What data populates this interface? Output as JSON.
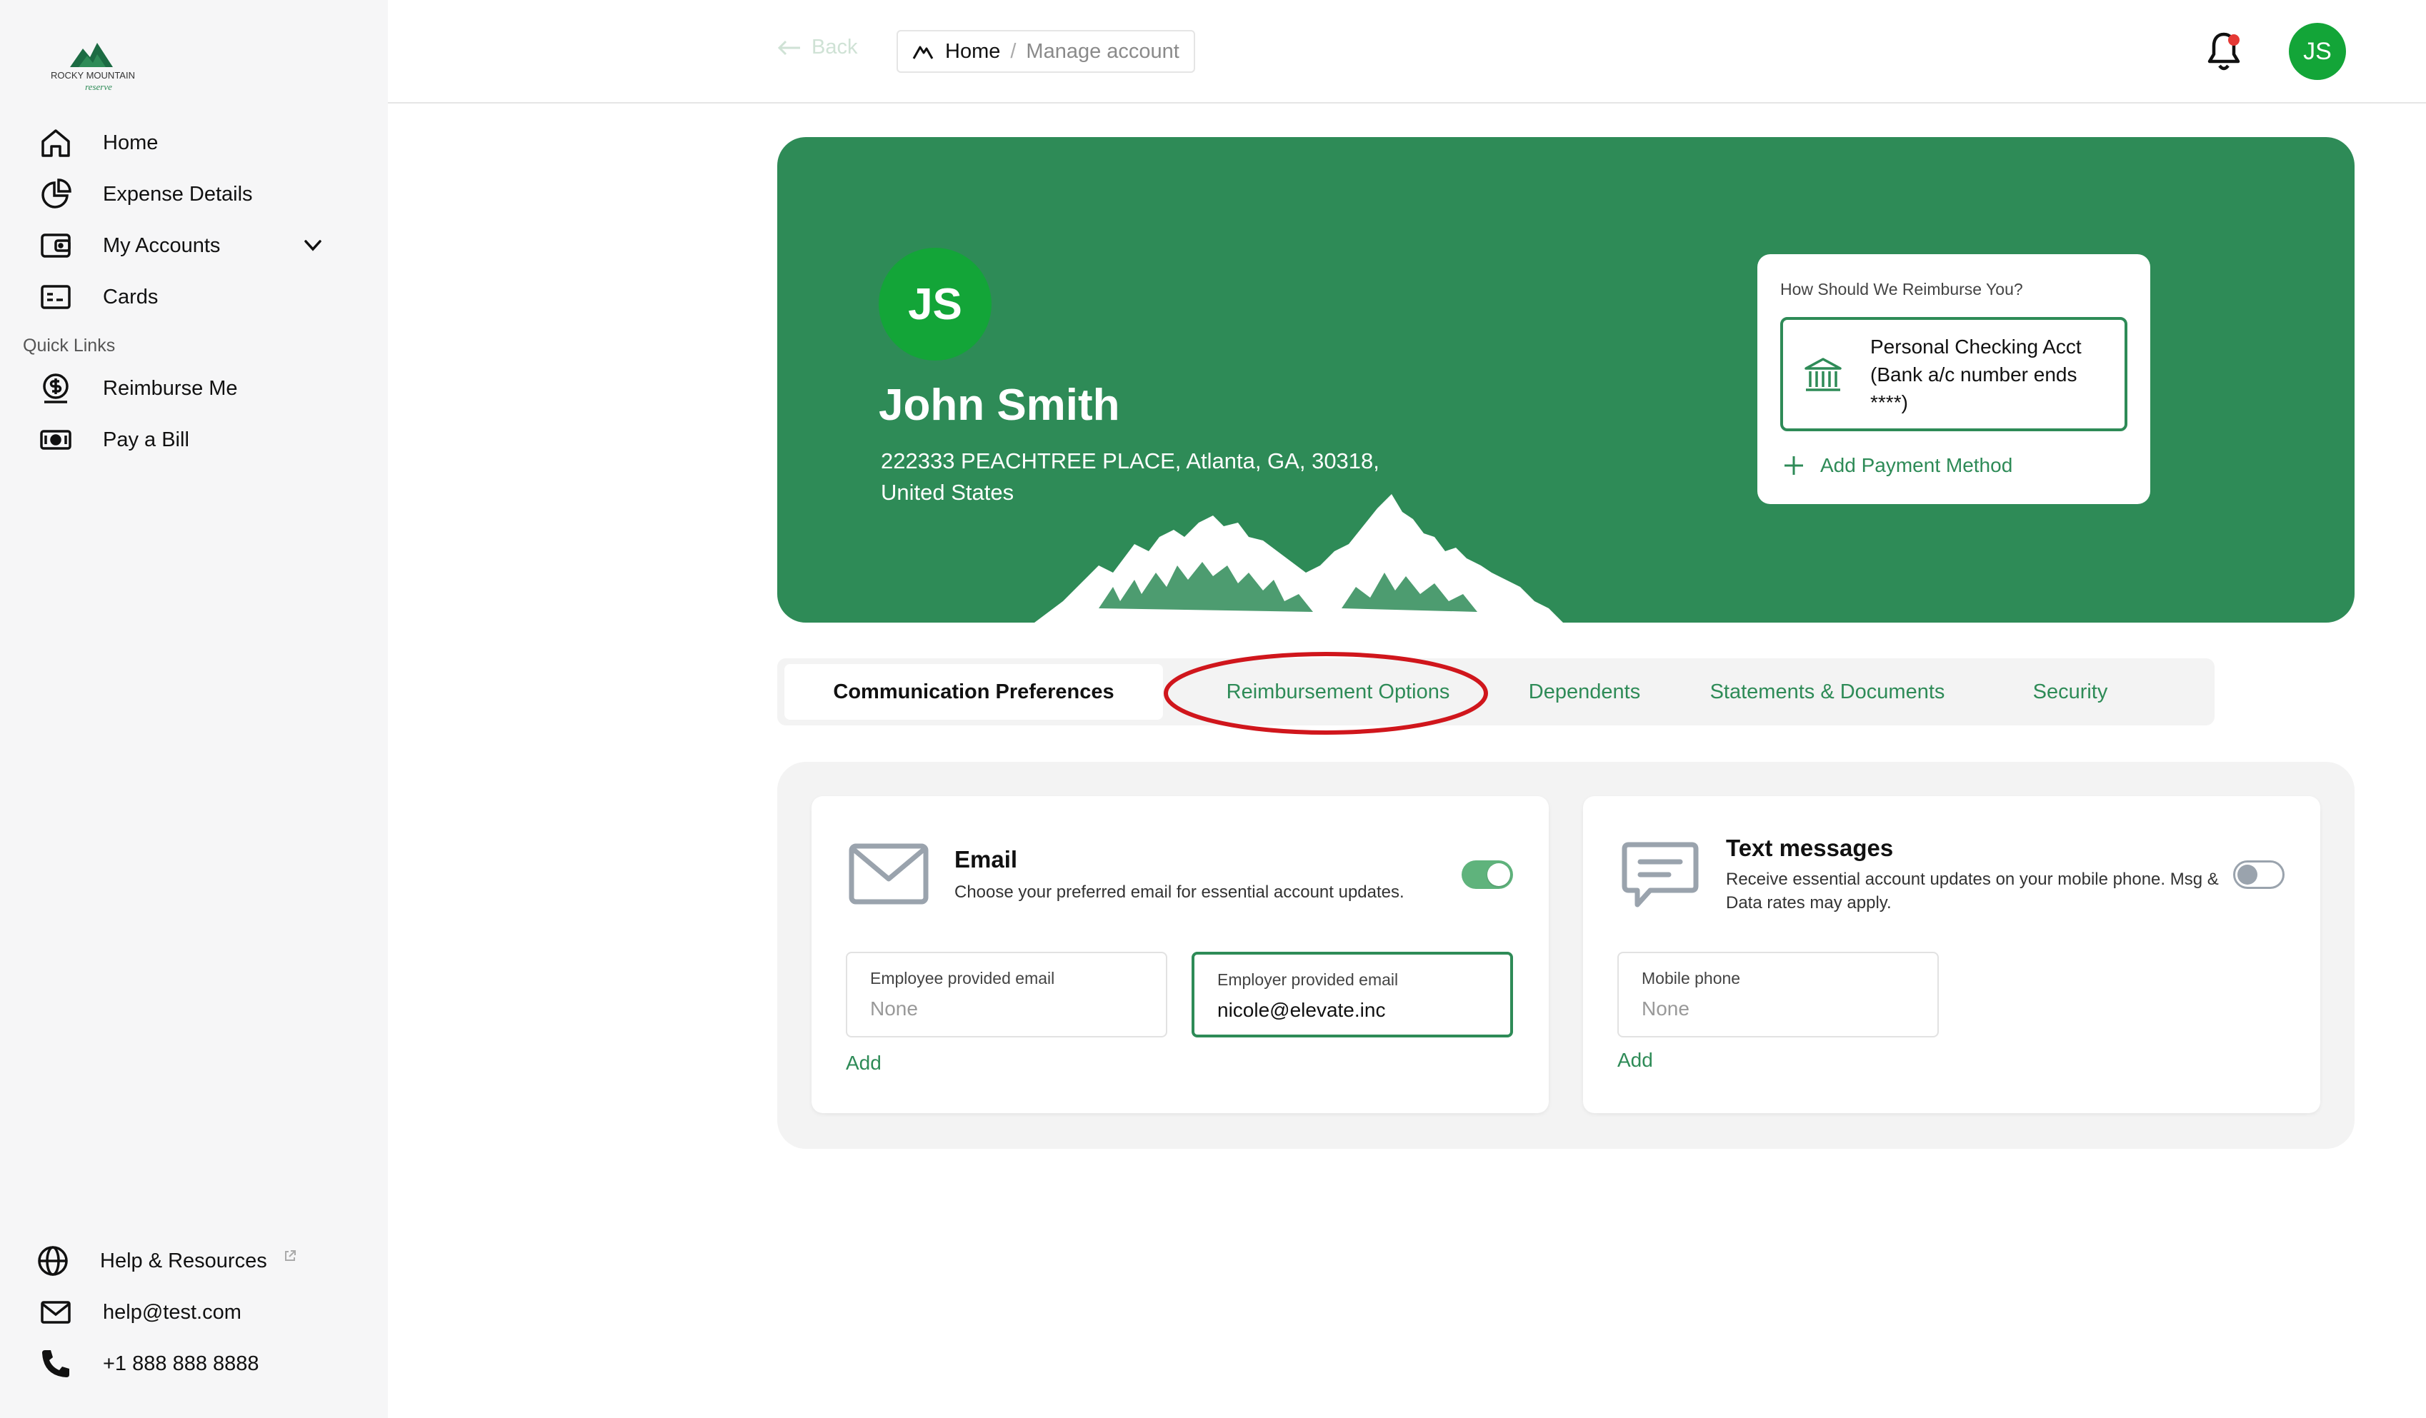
{
  "brand": {
    "logo_line1": "ROCKY MOUNTAIN",
    "logo_line2": "reserve",
    "primary_color": "#2e8b57",
    "avatar_color": "#13a538"
  },
  "sidebar": {
    "items": [
      {
        "label": "Home",
        "icon": "home-icon"
      },
      {
        "label": "Expense Details",
        "icon": "pie-chart-icon"
      },
      {
        "label": "My Accounts",
        "icon": "wallet-icon"
      },
      {
        "label": "Cards",
        "icon": "card-icon"
      }
    ],
    "quick_links_label": "Quick Links",
    "quick_links": [
      {
        "label": "Reimburse Me",
        "icon": "dollar-circle-icon"
      },
      {
        "label": "Pay a Bill",
        "icon": "cash-icon"
      }
    ],
    "footer": [
      {
        "label": "Help & Resources",
        "icon": "globe-icon"
      },
      {
        "label": "help@test.com",
        "icon": "mail-icon"
      },
      {
        "label": "+1 888 888 8888",
        "icon": "phone-icon"
      }
    ]
  },
  "topbar": {
    "back_label": "Back",
    "breadcrumb": {
      "home": "Home",
      "separator": "/",
      "current": "Manage account"
    },
    "user_initials": "JS"
  },
  "profile": {
    "initials": "JS",
    "name": "John Smith",
    "address": "222333 PEACHTREE PLACE,  Atlanta,  GA,  30318, United States"
  },
  "reimbursement": {
    "title": "How Should We Reimburse You?",
    "account_text": "Personal Checking Acct (Bank a/c number ends ****)",
    "add_label": "Add Payment Method"
  },
  "tabs": [
    {
      "label": "Communication Preferences",
      "active": true
    },
    {
      "label": "Reimbursement Options",
      "active": false
    },
    {
      "label": "Dependents",
      "active": false
    },
    {
      "label": "Statements & Documents",
      "active": false
    },
    {
      "label": "Security",
      "active": false
    }
  ],
  "annotation_color": "#d0161c",
  "email_card": {
    "title": "Email",
    "description": "Choose your preferred email for essential account updates.",
    "enabled": true,
    "employee_label": "Employee provided email",
    "employee_value": "None",
    "employer_label": "Employer provided email",
    "employer_value": "nicole@elevate.inc",
    "add_label": "Add"
  },
  "text_card": {
    "title": "Text messages",
    "description": "Receive essential account updates on your mobile phone. Msg & Data rates may apply.",
    "enabled": false,
    "phone_label": "Mobile phone",
    "phone_value": "None",
    "add_label": "Add"
  }
}
